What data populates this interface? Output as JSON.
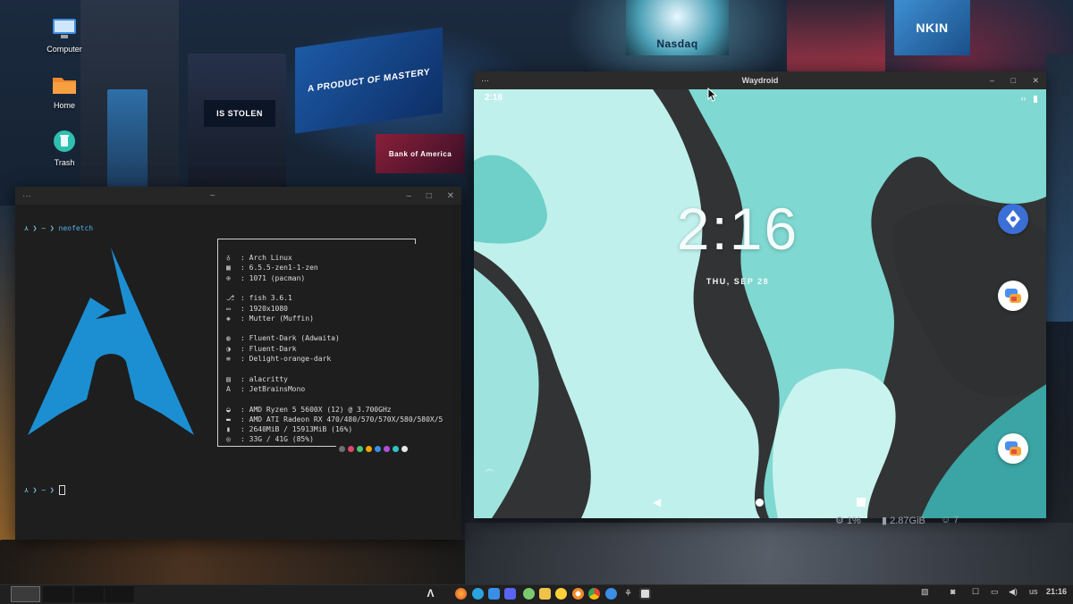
{
  "desktop": {
    "icons": [
      {
        "label": "Computer",
        "icon": "monitor-icon"
      },
      {
        "label": "Home",
        "icon": "folder-icon"
      },
      {
        "label": "Trash",
        "icon": "trash-icon"
      }
    ],
    "wallpaper": {
      "billboards": [
        "A PRODUCT OF MASTERY",
        "Nasdaq",
        "IS STOLEN",
        "Bank of America",
        "NKIN"
      ]
    }
  },
  "terminal": {
    "title": "~",
    "menu_dots": "···",
    "prompt_symbol": "⋏ ❯ ~ ❯",
    "command": "neofetch",
    "info": [
      {
        "icon": "arch-icon",
        "glyph": "♁",
        "text": ": Arch Linux"
      },
      {
        "icon": "kernel-icon",
        "glyph": "▦",
        "text": ": 6.5.5-zen1-1-zen"
      },
      {
        "icon": "package-icon",
        "glyph": "⊕",
        "text": ": 1071 (pacman)"
      },
      {
        "icon": "shell-icon",
        "glyph": "⎇",
        "text": ": fish 3.6.1"
      },
      {
        "icon": "display-icon",
        "glyph": "▭",
        "text": ": 1920x1080"
      },
      {
        "icon": "wm-icon",
        "glyph": "◈",
        "text": ": Mutter (Muffin)"
      },
      {
        "icon": "theme-icon",
        "glyph": "◍",
        "text": ": Fluent-Dark (Adwaita)"
      },
      {
        "icon": "icons-icon",
        "glyph": "◑",
        "text": ": Fluent-Dark"
      },
      {
        "icon": "cursor-icon",
        "glyph": "≡",
        "text": ": Delight-orange-dark"
      },
      {
        "icon": "terminal-icon",
        "glyph": "▤",
        "text": ": alacritty"
      },
      {
        "icon": "font-icon",
        "glyph": "A",
        "text": ": JetBrainsMono"
      },
      {
        "icon": "cpu-icon",
        "glyph": "◒",
        "text": ": AMD Ryzen 5 5600X (12) @ 3.700GHz"
      },
      {
        "icon": "gpu-icon",
        "glyph": "▬",
        "text": ": AMD ATI Radeon RX 470/480/570/570X/580/580X/5"
      },
      {
        "icon": "memory-icon",
        "glyph": "▮",
        "text": ": 2640MiB / 15913MiB (16%)"
      },
      {
        "icon": "disk-icon",
        "glyph": "◎",
        "text": ": 33G / 41G (85%)"
      }
    ],
    "color_dots": [
      "#6f6f6f",
      "#e0466b",
      "#48c774",
      "#f0a500",
      "#3a8ee6",
      "#b04fd6",
      "#2ec4c4",
      "#e6e6e6"
    ],
    "logo_color": "#1b8fd2"
  },
  "waydroid": {
    "title": "Waydroid",
    "menu_dots": "···",
    "status_time": "2:16",
    "clock": "2:16",
    "date": "THU, SEP 28",
    "nav": [
      "back-icon",
      "home-icon",
      "recents-icon"
    ]
  },
  "desktop_widgets": {
    "cpu": "1%",
    "memory": "2.87GiB",
    "users": "7"
  },
  "taskbar": {
    "apps": [
      "arch-menu-icon",
      "firefox-icon",
      "telegram-icon",
      "files-icon",
      "discord-icon",
      "notes-icon",
      "folder-icon",
      "emoji-icon",
      "blender-icon",
      "chrome-icon",
      "settings-icon",
      "app-icon",
      "waydroid-icon"
    ],
    "keyboard_layout": "us",
    "time": "21:16"
  }
}
